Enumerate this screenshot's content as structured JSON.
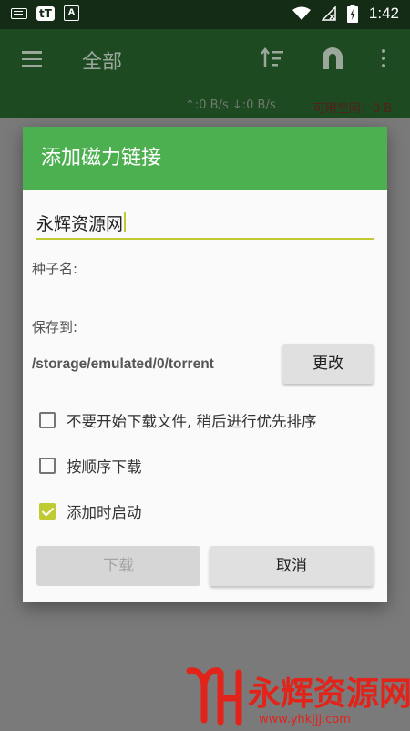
{
  "status_bar": {
    "icons": [
      "keyboard-icon",
      "tt-app-icon",
      "a-app-icon",
      "wifi-icon",
      "battery-icon"
    ],
    "tt_label": "tT",
    "a_label": "A",
    "time": "1:42"
  },
  "toolbar": {
    "title": "全部",
    "menu_icon": "menu-icon",
    "sort_icon": "sort-icon",
    "magnet_icon": "magnet-icon",
    "more_icon": "more-vert-icon",
    "speed": "↑:0 B/s ↓:0 B/s",
    "free_space": "可用空间：0 B"
  },
  "dialog": {
    "title": "添加磁力链接",
    "magnet_value": "永辉资源网",
    "seed_name_label": "种子名:",
    "save_to_label": "保存到:",
    "save_path": "/storage/emulated/0/torrent",
    "change_button": "更改",
    "options": [
      {
        "label": "不要开始下载文件, 稍后进行优先排序",
        "checked": false
      },
      {
        "label": "按顺序下载",
        "checked": false
      },
      {
        "label": "添加时启动",
        "checked": true
      }
    ],
    "download_button": "下载",
    "cancel_button": "取消"
  },
  "watermark": {
    "text": "永辉资源网",
    "url": "www.yhkjjj.com"
  },
  "colors": {
    "header_green": "#4caf50",
    "toolbar_green": "#1e4a22",
    "accent_lime": "#c0ca33",
    "watermark_red": "#e2231a"
  }
}
